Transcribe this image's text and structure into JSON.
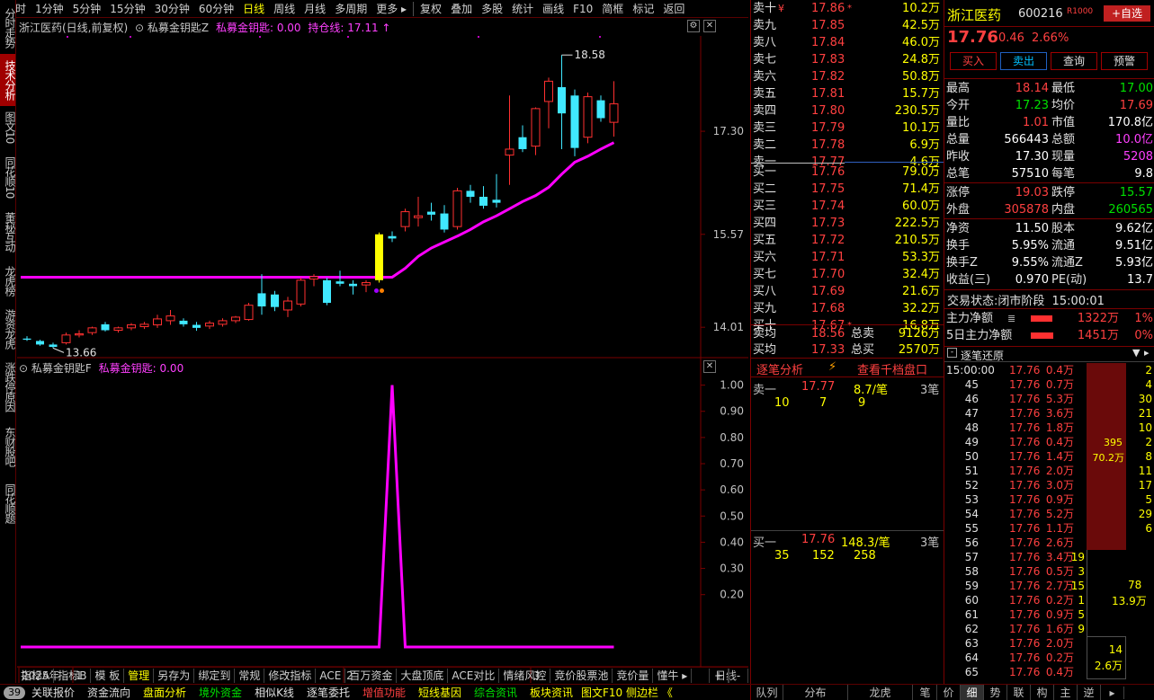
{
  "top_menu": {
    "items": [
      "分时",
      "1分钟",
      "5分钟",
      "15分钟",
      "30分钟",
      "60分钟",
      "日线",
      "周线",
      "月线",
      "多周期",
      "更多 ▸",
      "复权",
      "叠加",
      "多股",
      "统计",
      "画线",
      "F10",
      "简框",
      "标记",
      "返回"
    ],
    "active": "日线"
  },
  "left_tabs": [
    "分时走势",
    "技术分析",
    "图文10",
    "同花顺10",
    "董秘互动",
    "龙虎榜",
    "游资龙虎",
    "涨跌停原因",
    "东财股吧",
    "同花顺题"
  ],
  "main_chart": {
    "caption_title": "浙江医药(日线,前复权)",
    "indicator_name": "私募金钥匙Z",
    "indicator_value": "私募金钥匙: 0.00",
    "hold_line": "持仓线: 17.11",
    "price_labels": [
      "17.30",
      "15.57",
      "14.01"
    ],
    "high_marker": "18.58",
    "low_marker": "13.66"
  },
  "chart_data": [
    {
      "type": "candlestick",
      "title": "浙江医药(日线,前复权)",
      "y_ticks": [
        17.3,
        15.57,
        14.01
      ],
      "ylim": [
        13.5,
        18.9
      ],
      "candles": [
        {
          "o": 13.82,
          "h": 13.86,
          "l": 13.78,
          "c": 13.8
        },
        {
          "o": 13.78,
          "h": 13.8,
          "l": 13.7,
          "c": 13.72
        },
        {
          "o": 13.72,
          "h": 13.75,
          "l": 13.66,
          "c": 13.68
        },
        {
          "o": 13.75,
          "h": 13.92,
          "l": 13.72,
          "c": 13.88
        },
        {
          "o": 13.88,
          "h": 13.96,
          "l": 13.84,
          "c": 13.9
        },
        {
          "o": 13.92,
          "h": 14.02,
          "l": 13.88,
          "c": 14.0
        },
        {
          "o": 14.06,
          "h": 14.1,
          "l": 13.94,
          "c": 13.96
        },
        {
          "o": 13.96,
          "h": 14.02,
          "l": 13.92,
          "c": 14.0
        },
        {
          "o": 14.0,
          "h": 14.08,
          "l": 13.96,
          "c": 14.05
        },
        {
          "o": 14.02,
          "h": 14.1,
          "l": 13.98,
          "c": 14.06
        },
        {
          "o": 14.05,
          "h": 14.22,
          "l": 14.0,
          "c": 14.15
        },
        {
          "o": 14.12,
          "h": 14.3,
          "l": 14.05,
          "c": 14.2
        },
        {
          "o": 14.12,
          "h": 14.16,
          "l": 14.02,
          "c": 14.06
        },
        {
          "o": 14.05,
          "h": 14.1,
          "l": 13.95,
          "c": 14.0
        },
        {
          "o": 14.03,
          "h": 14.12,
          "l": 13.98,
          "c": 14.08
        },
        {
          "o": 14.06,
          "h": 14.16,
          "l": 14.02,
          "c": 14.12
        },
        {
          "o": 14.12,
          "h": 14.2,
          "l": 14.08,
          "c": 14.18
        },
        {
          "o": 14.14,
          "h": 14.42,
          "l": 14.12,
          "c": 14.38
        },
        {
          "o": 14.58,
          "h": 14.9,
          "l": 14.22,
          "c": 14.36
        },
        {
          "o": 14.56,
          "h": 14.62,
          "l": 14.28,
          "c": 14.35
        },
        {
          "o": 14.3,
          "h": 14.52,
          "l": 14.18,
          "c": 14.45
        },
        {
          "o": 14.4,
          "h": 14.84,
          "l": 14.36,
          "c": 14.8
        },
        {
          "o": 14.82,
          "h": 14.9,
          "l": 14.7,
          "c": 14.86
        },
        {
          "o": 14.8,
          "h": 14.84,
          "l": 14.38,
          "c": 14.42
        },
        {
          "o": 14.78,
          "h": 14.96,
          "l": 14.7,
          "c": 14.74
        },
        {
          "o": 14.74,
          "h": 14.8,
          "l": 14.56,
          "c": 14.7
        },
        {
          "o": 14.72,
          "h": 14.8,
          "l": 14.6,
          "c": 14.76
        },
        {
          "o": 14.8,
          "h": 15.6,
          "l": 14.76,
          "c": 15.57
        },
        {
          "o": 15.54,
          "h": 15.62,
          "l": 15.44,
          "c": 15.5
        },
        {
          "o": 15.7,
          "h": 16.0,
          "l": 15.62,
          "c": 15.95
        },
        {
          "o": 15.85,
          "h": 16.2,
          "l": 15.7,
          "c": 15.88
        },
        {
          "o": 15.95,
          "h": 16.1,
          "l": 15.8,
          "c": 15.9
        },
        {
          "o": 15.92,
          "h": 16.06,
          "l": 15.6,
          "c": 15.65
        },
        {
          "o": 15.7,
          "h": 16.35,
          "l": 15.65,
          "c": 16.3
        },
        {
          "o": 16.3,
          "h": 16.4,
          "l": 16.1,
          "c": 16.2
        },
        {
          "o": 16.2,
          "h": 16.38,
          "l": 16.0,
          "c": 16.05
        },
        {
          "o": 16.15,
          "h": 16.58,
          "l": 16.02,
          "c": 16.1
        },
        {
          "o": 16.9,
          "h": 17.9,
          "l": 16.4,
          "c": 17.0
        },
        {
          "o": 17.2,
          "h": 17.4,
          "l": 16.95,
          "c": 17.0
        },
        {
          "o": 17.05,
          "h": 17.7,
          "l": 16.9,
          "c": 17.68
        },
        {
          "o": 17.8,
          "h": 18.2,
          "l": 17.35,
          "c": 18.14
        },
        {
          "o": 18.04,
          "h": 18.58,
          "l": 17.0,
          "c": 17.6
        },
        {
          "o": 17.9,
          "h": 18.0,
          "l": 16.88,
          "c": 17.02
        },
        {
          "o": 17.2,
          "h": 17.95,
          "l": 17.1,
          "c": 17.88
        },
        {
          "o": 17.82,
          "h": 17.9,
          "l": 17.46,
          "c": 17.52
        },
        {
          "o": 17.45,
          "h": 18.14,
          "l": 17.21,
          "c": 17.76
        }
      ],
      "hold_line": [
        14.85,
        14.85,
        14.85,
        14.85,
        14.85,
        14.85,
        14.85,
        14.85,
        14.85,
        14.85,
        14.85,
        14.85,
        14.85,
        14.85,
        14.85,
        14.85,
        14.85,
        14.85,
        14.85,
        14.85,
        14.85,
        14.85,
        14.85,
        14.85,
        14.85,
        14.85,
        14.85,
        14.85,
        14.85,
        15.0,
        15.2,
        15.34,
        15.44,
        15.54,
        15.65,
        15.78,
        15.88,
        16.0,
        16.12,
        16.22,
        16.36,
        16.58,
        16.78,
        16.88,
        17.0,
        17.11
      ],
      "signal_index": 27
    },
    {
      "type": "line",
      "title": "私募金钥匙F",
      "y_ticks": [
        1.0,
        0.9,
        0.8,
        0.7,
        0.6,
        0.5,
        0.4,
        0.3,
        0.2
      ],
      "ylim": [
        0.0,
        1.05
      ],
      "values": [
        0,
        0,
        0,
        0,
        0,
        0,
        0,
        0,
        0,
        0,
        0,
        0,
        0,
        0,
        0,
        0,
        0,
        0,
        0,
        0,
        0,
        0,
        0,
        0,
        0,
        0,
        0,
        0,
        1,
        0,
        0,
        0,
        0,
        0,
        0,
        0,
        0,
        0,
        0,
        0,
        0,
        0,
        0,
        0,
        0,
        0
      ]
    }
  ],
  "sub_chart": {
    "caption_name": "私募金钥匙F",
    "caption_value": "私募金钥匙: 0.00",
    "y_labels": [
      "1.00",
      "0.90",
      "0.80",
      "0.70",
      "0.60",
      "0.50",
      "0.40",
      "0.30",
      "0.20"
    ],
    "x_labels": [
      "2025年",
      "1",
      "2",
      "3"
    ],
    "x_right_label": "日线"
  },
  "bottom_tabs": {
    "items": [
      "指标A",
      "指标B",
      "模 板",
      "管理",
      "另存为",
      "绑定到",
      "常规",
      "修改指标",
      "ACE",
      "百万资金",
      "大盘顶底",
      "ACE对比",
      "情绪风控",
      "竞价股票池",
      "竞价量",
      "懂牛 ▸"
    ],
    "active": "管理",
    "right_controls": [
      "+",
      "-"
    ]
  },
  "order_book": {
    "asks": [
      {
        "label": "卖十",
        "mark": "¥",
        "price": "17.86",
        "flag": "*",
        "vol": "10.2万"
      },
      {
        "label": "卖九",
        "mark": "",
        "price": "17.85",
        "flag": "",
        "vol": "42.5万"
      },
      {
        "label": "卖八",
        "mark": "",
        "price": "17.84",
        "flag": "",
        "vol": "46.0万"
      },
      {
        "label": "卖七",
        "mark": "",
        "price": "17.83",
        "flag": "",
        "vol": "24.8万"
      },
      {
        "label": "卖六",
        "mark": "",
        "price": "17.82",
        "flag": "",
        "vol": "50.8万"
      },
      {
        "label": "卖五",
        "mark": "",
        "price": "17.81",
        "flag": "",
        "vol": "15.7万"
      },
      {
        "label": "卖四",
        "mark": "",
        "price": "17.80",
        "flag": "",
        "vol": "230.5万"
      },
      {
        "label": "卖三",
        "mark": "",
        "price": "17.79",
        "flag": "",
        "vol": "10.1万"
      },
      {
        "label": "卖二",
        "mark": "",
        "price": "17.78",
        "flag": "",
        "vol": "6.9万"
      },
      {
        "label": "卖一",
        "mark": "",
        "price": "17.77",
        "flag": "",
        "vol": "4.6万"
      }
    ],
    "bids": [
      {
        "label": "买一",
        "price": "17.76",
        "flag": "",
        "vol": "79.0万"
      },
      {
        "label": "买二",
        "price": "17.75",
        "flag": "",
        "vol": "71.4万"
      },
      {
        "label": "买三",
        "price": "17.74",
        "flag": "",
        "vol": "60.0万"
      },
      {
        "label": "买四",
        "price": "17.73",
        "flag": "",
        "vol": "222.5万"
      },
      {
        "label": "买五",
        "price": "17.72",
        "flag": "",
        "vol": "210.5万"
      },
      {
        "label": "买六",
        "price": "17.71",
        "flag": "",
        "vol": "53.3万"
      },
      {
        "label": "买七",
        "price": "17.70",
        "flag": "",
        "vol": "32.4万"
      },
      {
        "label": "买八",
        "price": "17.69",
        "flag": "",
        "vol": "21.6万"
      },
      {
        "label": "买九",
        "price": "17.68",
        "flag": "",
        "vol": "32.2万"
      },
      {
        "label": "买十",
        "price": "17.67",
        "flag": "*",
        "vol": "16.8万"
      }
    ],
    "avg_sell": {
      "label": "卖均",
      "price": "18.56",
      "total_label": "总卖",
      "total": "9126万"
    },
    "avg_buy": {
      "label": "买均",
      "price": "17.33",
      "total_label": "总买",
      "total": "2570万"
    }
  },
  "tick_analysis": {
    "tab1": "逐笔分析",
    "lightning": "⚡",
    "tab2": "查看千档盘口",
    "sell1": {
      "label": "卖一",
      "price": "17.77",
      "size": "8.7/笔",
      "count": "3笔"
    },
    "sell_lots": [
      "10",
      "7",
      "9"
    ],
    "buy1": {
      "label": "买一",
      "price": "17.76",
      "size": "148.3/笔",
      "count": "3笔"
    },
    "buy_lots": [
      "35",
      "152",
      "258"
    ]
  },
  "stock": {
    "name": "浙江医药",
    "code": "600216",
    "level": "R1000",
    "add_btn": "+自选",
    "price": "17.76",
    "change": "0.46",
    "pct": "2.66%",
    "actions": [
      "买入",
      "卖出",
      "查询",
      "预警"
    ]
  },
  "fundamentals": [
    {
      "l1": "最高",
      "v1": "18.14",
      "c1": "red",
      "l2": "最低",
      "v2": "17.00",
      "c2": "green"
    },
    {
      "l1": "今开",
      "v1": "17.23",
      "c1": "green",
      "l2": "均价",
      "v2": "17.69",
      "c2": "red"
    },
    {
      "l1": "量比",
      "v1": "1.01",
      "c1": "red",
      "l2": "市值",
      "v2": "170.8亿",
      "c2": "white"
    },
    {
      "l1": "总量",
      "v1": "566443",
      "c1": "white",
      "l2": "总额",
      "v2": "10.0亿",
      "c2": "mag"
    },
    {
      "l1": "昨收",
      "v1": "17.30",
      "c1": "white",
      "l2": "现量",
      "v2": "5208",
      "c2": "mag"
    },
    {
      "l1": "总笔",
      "v1": "57510",
      "c1": "white",
      "l2": "每笔",
      "v2": "9.8",
      "c2": "white"
    },
    {
      "l1": "涨停",
      "v1": "19.03",
      "c1": "red",
      "l2": "跌停",
      "v2": "15.57",
      "c2": "green"
    },
    {
      "l1": "外盘",
      "v1": "305878",
      "c1": "red",
      "l2": "内盘",
      "v2": "260565",
      "c2": "green"
    },
    {
      "l1": "净资",
      "v1": "11.50",
      "c1": "white",
      "l2": "股本",
      "v2": "9.62亿",
      "c2": "white"
    },
    {
      "l1": "换手",
      "v1": "5.95%",
      "c1": "white",
      "l2": "流通",
      "v2": "9.51亿",
      "c2": "white"
    },
    {
      "l1": "换手Z",
      "v1": "9.55%",
      "c1": "white",
      "l2": "流通Z",
      "v2": "5.93亿",
      "c2": "white"
    },
    {
      "l1": "收益(三)",
      "v1": "0.970",
      "c1": "white",
      "l2": "PE(动)",
      "v2": "13.7",
      "c2": "white"
    }
  ],
  "trade_state": {
    "label": "交易状态:",
    "state": "闭市阶段",
    "time": "15:00:01"
  },
  "net_flow": [
    {
      "label": "主力净额",
      "value": "1322万",
      "pct": "1%",
      "bar": 0.6
    },
    {
      "label": "5日主力净额",
      "value": "1451万",
      "pct": "0%",
      "bar": 0.62
    }
  ],
  "tape": {
    "title": "逐笔还原",
    "rows": [
      {
        "t": "15:00:00",
        "p": "17.76",
        "v": "0.4万",
        "n": "2"
      },
      {
        "t": "45",
        "p": "17.76",
        "v": "0.7万",
        "n": "4"
      },
      {
        "t": "46",
        "p": "17.76",
        "v": "5.3万",
        "n": "30"
      },
      {
        "t": "47",
        "p": "17.76",
        "v": "3.6万",
        "n": "21"
      },
      {
        "t": "48",
        "p": "17.76",
        "v": "1.8万",
        "n": "10"
      },
      {
        "t": "49",
        "p": "17.76",
        "v": "0.4万",
        "n": "2"
      },
      {
        "t": "50",
        "p": "17.76",
        "v": "1.4万",
        "n": "8"
      },
      {
        "t": "51",
        "p": "17.76",
        "v": "2.0万",
        "n": "11"
      },
      {
        "t": "52",
        "p": "17.76",
        "v": "3.0万",
        "n": "17"
      },
      {
        "t": "53",
        "p": "17.76",
        "v": "0.9万",
        "n": "5"
      },
      {
        "t": "54",
        "p": "17.76",
        "v": "5.2万",
        "n": "29"
      },
      {
        "t": "55",
        "p": "17.76",
        "v": "1.1万",
        "n": "6"
      },
      {
        "t": "56",
        "p": "17.76",
        "v": "2.6万",
        "n": ""
      },
      {
        "t": "57",
        "p": "17.76",
        "v": "3.4万",
        "n": "19"
      },
      {
        "t": "58",
        "p": "17.76",
        "v": "0.5万",
        "n": "3"
      },
      {
        "t": "59",
        "p": "17.76",
        "v": "2.7万",
        "n": "15"
      },
      {
        "t": "60",
        "p": "17.76",
        "v": "0.2万",
        "n": "1"
      },
      {
        "t": "61",
        "p": "17.76",
        "v": "0.9万",
        "n": "5"
      },
      {
        "t": "62",
        "p": "17.76",
        "v": "1.6万",
        "n": "9"
      },
      {
        "t": "63",
        "p": "17.76",
        "v": "2.0万",
        "n": ""
      },
      {
        "t": "64",
        "p": "17.76",
        "v": "0.2万",
        "n": ""
      },
      {
        "t": "65",
        "p": "17.76",
        "v": "0.4万",
        "n": ""
      }
    ],
    "block1": {
      "count": "395",
      "amount": "70.2万"
    },
    "side_78": "78",
    "side_139": "13.9万",
    "block2": {
      "count": "14",
      "amount": "2.6万"
    }
  },
  "right_tabs": [
    "笔",
    "价",
    "细",
    "势",
    "联",
    "构",
    "主",
    "逆",
    "▸"
  ],
  "right_tabs_active": "细",
  "status_bar": {
    "badge": "39",
    "items": [
      "关联报价",
      "资金流向",
      "盘面分析",
      "境外资金",
      "相似K线",
      "逐笔委托",
      "增值功能",
      "短线基因",
      "综合资讯",
      "板块资讯"
    ],
    "tail": "图文F10 侧边栏 《",
    "right_items": [
      "队列",
      "分布",
      "龙虎"
    ]
  }
}
